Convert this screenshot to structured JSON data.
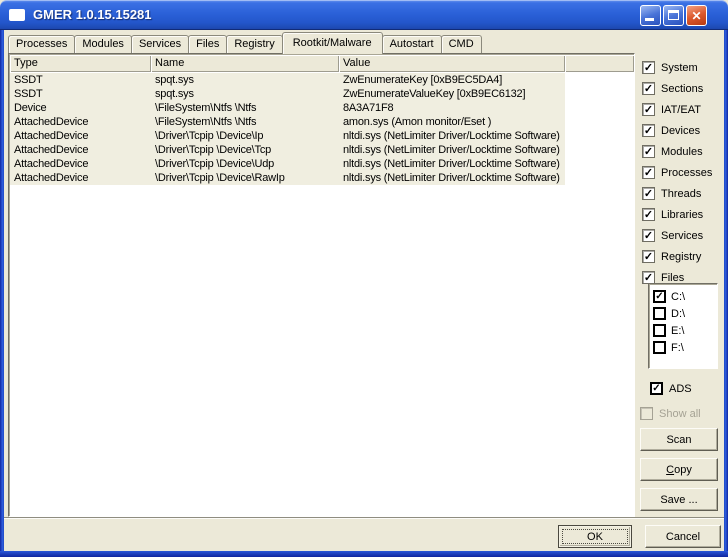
{
  "window": {
    "title": "GMER 1.0.15.15281"
  },
  "icons": {
    "checkmark": "✓",
    "close": "✕"
  },
  "colors": {
    "titlebar_blue": "#2b61d8",
    "window_border_blue": "#1e48c4",
    "dialog_face": "#ece9d8",
    "row_background": "#f0eee0",
    "close_button_red": "#dd5a2e",
    "disabled_text": "#a5a294"
  },
  "tabs": {
    "items": [
      {
        "label": "Processes",
        "active": false
      },
      {
        "label": "Modules",
        "active": false
      },
      {
        "label": "Services",
        "active": false
      },
      {
        "label": "Files",
        "active": false
      },
      {
        "label": "Registry",
        "active": false
      },
      {
        "label": "Rootkit/Malware",
        "active": true
      },
      {
        "label": "Autostart",
        "active": false
      },
      {
        "label": "CMD",
        "active": false
      }
    ]
  },
  "table": {
    "columns": {
      "type": "Type",
      "name": "Name",
      "value": "Value"
    },
    "rows": [
      {
        "type": "SSDT",
        "name": "spqt.sys",
        "value": "ZwEnumerateKey [0xB9EC5DA4]"
      },
      {
        "type": "SSDT",
        "name": "spqt.sys",
        "value": "ZwEnumerateValueKey [0xB9EC6132]"
      },
      {
        "type": "Device",
        "name": "\\FileSystem\\Ntfs \\Ntfs",
        "value": "8A3A71F8"
      },
      {
        "type": "AttachedDevice",
        "name": "\\FileSystem\\Ntfs \\Ntfs",
        "value": "amon.sys (Amon monitor/Eset )"
      },
      {
        "type": "AttachedDevice",
        "name": "\\Driver\\Tcpip \\Device\\Ip",
        "value": "nltdi.sys (NetLimiter Driver/Locktime Software)"
      },
      {
        "type": "AttachedDevice",
        "name": "\\Driver\\Tcpip \\Device\\Tcp",
        "value": "nltdi.sys (NetLimiter Driver/Locktime Software)"
      },
      {
        "type": "AttachedDevice",
        "name": "\\Driver\\Tcpip \\Device\\Udp",
        "value": "nltdi.sys (NetLimiter Driver/Locktime Software)"
      },
      {
        "type": "AttachedDevice",
        "name": "\\Driver\\Tcpip \\Device\\RawIp",
        "value": "nltdi.sys (NetLimiter Driver/Locktime Software)"
      }
    ]
  },
  "scan_options": {
    "items": [
      {
        "label": "System",
        "checked": true,
        "glyph": "✓"
      },
      {
        "label": "Sections",
        "checked": true,
        "glyph": "✓"
      },
      {
        "label": "IAT/EAT",
        "checked": true,
        "glyph": "✓"
      },
      {
        "label": "Devices",
        "checked": true,
        "glyph": "✓"
      },
      {
        "label": "Modules",
        "checked": true,
        "glyph": "✓"
      },
      {
        "label": "Processes",
        "checked": true,
        "glyph": "✓"
      },
      {
        "label": "Threads",
        "checked": true,
        "glyph": "✓"
      },
      {
        "label": "Libraries",
        "checked": true,
        "glyph": "✓"
      },
      {
        "label": "Services",
        "checked": true,
        "glyph": "✓"
      },
      {
        "label": "Registry",
        "checked": true,
        "glyph": "✓"
      },
      {
        "label": "Files",
        "checked": true,
        "glyph": "✓"
      }
    ]
  },
  "drives": {
    "items": [
      {
        "label": "C:\\",
        "checked": true,
        "glyph": "✓"
      },
      {
        "label": "D:\\",
        "checked": false,
        "glyph": ""
      },
      {
        "label": "E:\\",
        "checked": false,
        "glyph": ""
      },
      {
        "label": "F:\\",
        "checked": false,
        "glyph": ""
      }
    ]
  },
  "ads_option": {
    "label": "ADS",
    "checked": true,
    "glyph": "✓"
  },
  "show_all_option": {
    "label": "Show all",
    "checked": false,
    "disabled": true,
    "glyph": ""
  },
  "buttons": {
    "scan": "Scan",
    "copy_accel": "C",
    "copy_rest": "opy",
    "save": "Save ...",
    "ok": "OK",
    "cancel": "Cancel"
  }
}
